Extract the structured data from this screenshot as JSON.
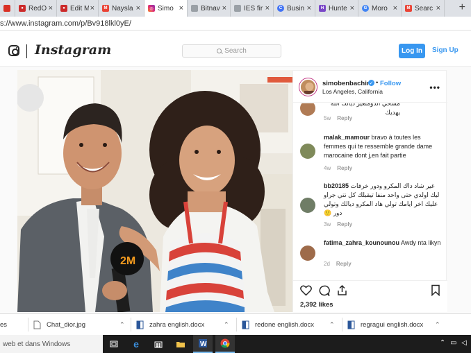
{
  "browser": {
    "tabs": [
      {
        "label": "",
        "favicon": "red-square-icon",
        "color": "#d93025"
      },
      {
        "label": "RedO",
        "favicon": "red-o-icon",
        "color": "#cc2a2a"
      },
      {
        "label": "Edit M",
        "favicon": "red-o-icon",
        "color": "#cc2a2a"
      },
      {
        "label": "Naysla",
        "favicon": "gmail-icon",
        "color": "#ea4335"
      },
      {
        "label": "Simo",
        "favicon": "instagram-icon",
        "color": "#c13584"
      },
      {
        "label": "Bitnav",
        "favicon": "document-icon",
        "color": "#9aa0a6"
      },
      {
        "label": "IES fir",
        "favicon": "document-icon",
        "color": "#9aa0a6"
      },
      {
        "label": "Busin",
        "favicon": "circle-c-icon",
        "color": "#4273f5"
      },
      {
        "label": "Hunte",
        "favicon": "hunter-icon",
        "color": "#7a47c7"
      },
      {
        "label": "Moro",
        "favicon": "google-icon",
        "color": "#4285f4"
      },
      {
        "label": "Searc",
        "favicon": "gmail-icon",
        "color": "#ea4335"
      }
    ],
    "new_tab": "+",
    "url": "s://www.instagram.com/p/Bv918lkl0yE/"
  },
  "instagram": {
    "wordmark": "Instagram",
    "search_placeholder": "Search",
    "login_label": "Log In",
    "signup_label": "Sign Up"
  },
  "post": {
    "author": "simobenbachir",
    "follow_separator": "•",
    "follow_label": "Follow",
    "location": "Los Angeles, California",
    "more_label": "•••",
    "comments": [
      {
        "user": "",
        "text": "مسحي الدومتعير ديالك الله يهديك",
        "time": "5w",
        "reply": "Reply",
        "avatar_color": "#b07b55"
      },
      {
        "user": "malak_mamour",
        "text": "bravo à toutes les femmes qui te ressemble grande dame marocaine dont j,en fait partie",
        "time": "4w",
        "reply": "Reply",
        "avatar_color": "#7f8a5a"
      },
      {
        "user": "bb20185",
        "text": "غير شاد داك المكرو ودور خرفات ليك اولدي حتى واحد منفا تيقبلك كل نتي جراو عليك اخر ايامك تولي هاد المكرو ديالك وتولي دور 🙂",
        "time": "3w",
        "reply": "Reply",
        "avatar_color": "#6f7d66"
      },
      {
        "user": "fatima_zahra_kounounou",
        "text": "Awdy nta likyn",
        "time": "2d",
        "reply": "Reply",
        "avatar_color": "#9e6b4a"
      }
    ],
    "likes": "2,392 likes"
  },
  "downloads": [
    {
      "name": "es",
      "icon": "file-icon"
    },
    {
      "name": "Chat_dior.jpg",
      "icon": "image-file-icon"
    },
    {
      "name": "zahra english.docx",
      "icon": "word-file-icon"
    },
    {
      "name": "redone english.docx",
      "icon": "word-file-icon"
    },
    {
      "name": "regragui english.docx",
      "icon": "word-file-icon"
    }
  ],
  "taskbar": {
    "search_text": "web et dans Windows"
  }
}
